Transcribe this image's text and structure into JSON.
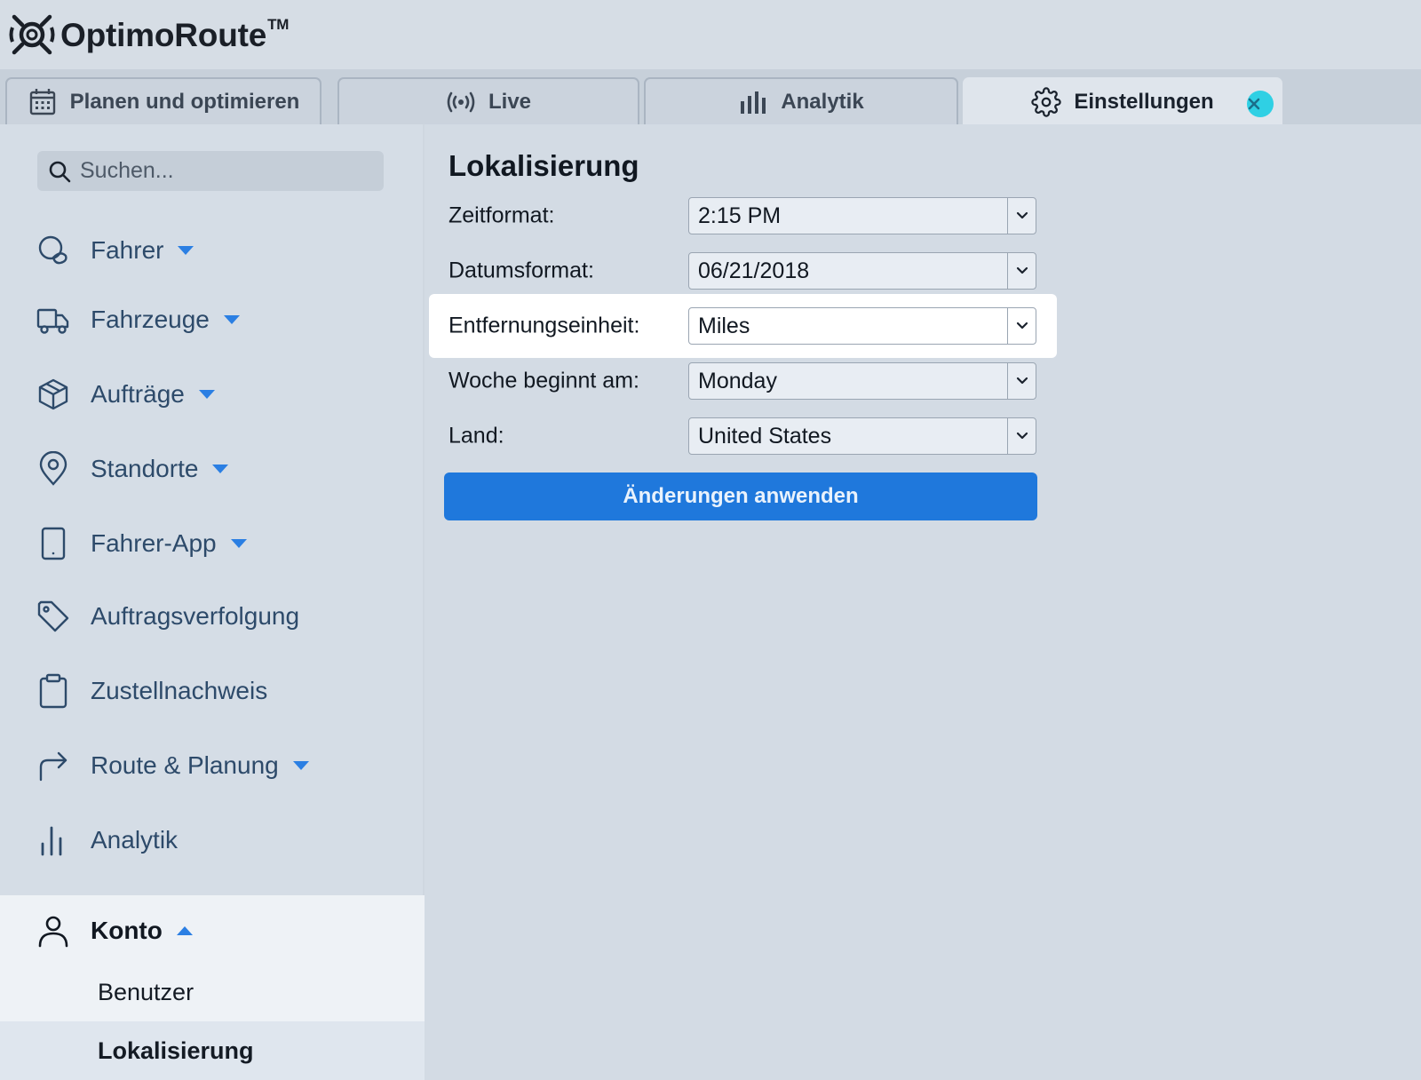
{
  "app": {
    "name": "OptimoRoute",
    "trademark": "TM"
  },
  "tabs": [
    {
      "label": "Planen und optimieren",
      "icon": "calendar-icon"
    },
    {
      "label": "Live",
      "icon": "broadcast-icon"
    },
    {
      "label": "Analytik",
      "icon": "bar-chart-icon"
    },
    {
      "label": "Einstellungen",
      "icon": "gear-icon",
      "active": true
    }
  ],
  "sidebar": {
    "search_placeholder": "Suchen...",
    "items": [
      {
        "label": "Fahrer",
        "icon": "driver-icon",
        "expandable": true
      },
      {
        "label": "Fahrzeuge",
        "icon": "truck-icon",
        "expandable": true
      },
      {
        "label": "Aufträge",
        "icon": "package-icon",
        "expandable": true
      },
      {
        "label": "Standorte",
        "icon": "location-pin-icon",
        "expandable": true
      },
      {
        "label": "Fahrer-App",
        "icon": "phone-icon",
        "expandable": true
      },
      {
        "label": "Auftragsverfolgung",
        "icon": "tag-icon",
        "expandable": false
      },
      {
        "label": "Zustellnachweis",
        "icon": "clipboard-icon",
        "expandable": false
      },
      {
        "label": "Route & Planung",
        "icon": "route-arrow-icon",
        "expandable": true
      },
      {
        "label": "Analytik",
        "icon": "bar-chart-icon",
        "expandable": false
      }
    ],
    "account": {
      "label": "Konto",
      "icon": "user-icon",
      "expanded": true,
      "sub_items": [
        {
          "label": "Benutzer"
        },
        {
          "label": "Lokalisierung",
          "active": true
        }
      ]
    }
  },
  "main": {
    "title": "Lokalisierung",
    "fields": [
      {
        "label": "Zeitformat:",
        "value": "2:15 PM"
      },
      {
        "label": "Datumsformat:",
        "value": "06/21/2018"
      },
      {
        "label": "Entfernungseinheit:",
        "value": "Miles",
        "highlighted": true
      },
      {
        "label": "Woche beginnt am:",
        "value": "Monday"
      },
      {
        "label": "Land:",
        "value": "United States"
      }
    ],
    "apply_label": "Änderungen anwenden"
  },
  "colors": {
    "accent": "#1f78dc",
    "caret": "#2b7fe3",
    "close_button": "#2fd0e4",
    "sidebar_text": "#2d4a6a"
  }
}
